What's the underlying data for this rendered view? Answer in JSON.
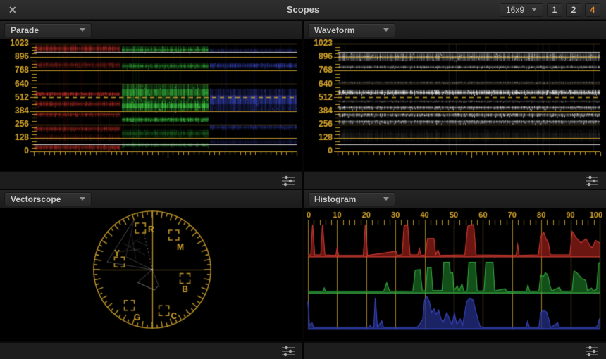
{
  "titlebar": {
    "close_glyph": "✕",
    "title": "Scopes",
    "aspect_value": "16x9",
    "layout_options": [
      "1",
      "2",
      "4"
    ],
    "active_layout": "4",
    "accent_color": "#e8872b"
  },
  "panels": {
    "parade": {
      "label": "Parade"
    },
    "waveform": {
      "label": "Waveform"
    },
    "vectorscope": {
      "label": "Vectorscope"
    },
    "histogram": {
      "label": "Histogram"
    }
  },
  "scale": {
    "labels": [
      "1023",
      "896",
      "768",
      "640",
      "512",
      "384",
      "256",
      "128",
      "0"
    ],
    "max": 1023,
    "dashed_value": 512,
    "white_lines": [
      940,
      64
    ],
    "grid_color": "#c49a2a",
    "label_color": "#d9a92c",
    "white_line_color": "#e6e6e6"
  },
  "chart_data": {
    "parade": {
      "type": "waveform-parade",
      "seed": 7,
      "channels": [
        {
          "name": "red",
          "color": "#e83a2e",
          "bands": [
            [
              975,
              35,
              0.5
            ],
            [
              820,
              30,
              0.3
            ],
            [
              545,
              20,
              0.65
            ],
            [
              450,
              25,
              0.4
            ],
            [
              350,
              20,
              0.45
            ],
            [
              215,
              25,
              0.4
            ],
            [
              130,
              30,
              0.18
            ],
            [
              40,
              28,
              0.45
            ]
          ]
        },
        {
          "name": "green",
          "color": "#44e04a",
          "bands": [
            [
              965,
              30,
              0.45
            ],
            [
              810,
              25,
              0.4
            ],
            [
              560,
              75,
              0.55
            ],
            [
              430,
              55,
              0.75
            ],
            [
              300,
              25,
              0.6
            ],
            [
              170,
              40,
              0.25
            ],
            [
              60,
              20,
              0.3
            ]
          ]
        },
        {
          "name": "blue",
          "color": "#4656e8",
          "bands": [
            [
              955,
              25,
              0.22
            ],
            [
              815,
              28,
              0.45
            ],
            [
              490,
              105,
              0.5
            ],
            [
              230,
              20,
              0.35
            ],
            [
              90,
              30,
              0.15
            ]
          ]
        }
      ]
    },
    "waveform": {
      "type": "waveform-luma",
      "seed": 13,
      "channels": [
        {
          "name": "luma",
          "color": "#e8e8e8",
          "bands": [
            [
              895,
              35,
              0.55
            ],
            [
              800,
              12,
              0.4
            ],
            [
              655,
              10,
              0.25
            ],
            [
              560,
              22,
              0.85
            ],
            [
              475,
              10,
              0.25
            ],
            [
              415,
              18,
              0.55
            ],
            [
              345,
              15,
              0.65
            ],
            [
              280,
              18,
              0.5
            ],
            [
              150,
              60,
              0.08
            ]
          ]
        }
      ]
    },
    "vectorscope": {
      "type": "vectorscope",
      "targets": [
        {
          "name": "R",
          "x": -0.2,
          "y": -0.71,
          "lx": -0.02,
          "ly": -0.68
        },
        {
          "name": "M",
          "x": 0.37,
          "y": -0.59,
          "lx": 0.48,
          "ly": -0.38
        },
        {
          "name": "Y",
          "x": -0.56,
          "y": -0.13,
          "lx": -0.6,
          "ly": -0.27
        },
        {
          "name": "B",
          "x": 0.56,
          "y": 0.15,
          "lx": 0.56,
          "ly": 0.34
        },
        {
          "name": "G",
          "x": -0.39,
          "y": 0.61,
          "lx": -0.26,
          "ly": 0.82
        },
        {
          "name": "C",
          "x": 0.2,
          "y": 0.7,
          "lx": 0.37,
          "ly": 0.8
        }
      ],
      "trace": [
        [
          -0.31,
          -0.85,
          -0.77,
          -0.13,
          0.35,
          0
        ],
        [
          0,
          0,
          -0.77,
          -0.13,
          0.3,
          0
        ],
        [
          0,
          0,
          -0.45,
          -0.22,
          0.3,
          0
        ],
        [
          -0.45,
          -0.22,
          -0.31,
          -0.85,
          0.2,
          0
        ],
        [
          -0.6,
          -0.3,
          -0.2,
          -0.35,
          0.2,
          0
        ],
        [
          -0.5,
          -0.45,
          -0.12,
          -0.25,
          0.2,
          0
        ],
        [
          -0.35,
          -0.6,
          -0.28,
          -0.18,
          0.18,
          0
        ],
        [
          -0.06,
          -0.4,
          -0.3,
          -0.5,
          0.18,
          0
        ],
        [
          -0.2,
          -0.55,
          -0.5,
          -0.3,
          0.15,
          0
        ],
        [
          -0.15,
          -0.66,
          0,
          -0.02,
          0.45,
          1
        ],
        [
          0,
          0,
          -0.25,
          0.22,
          0.35,
          0
        ],
        [
          -0.25,
          0.22,
          0.04,
          0.35,
          0.55,
          0
        ],
        [
          0.04,
          0.35,
          0.1,
          0.28,
          0.55,
          0
        ],
        [
          0,
          0,
          0.12,
          0.3,
          0.3,
          0
        ]
      ]
    },
    "histogram": {
      "type": "area",
      "axis_ticks": [
        0,
        10,
        20,
        30,
        40,
        50,
        60,
        70,
        80,
        90,
        100
      ],
      "series": [
        {
          "name": "red",
          "line": "#e04438",
          "fill": "rgba(150,30,25,0.72)",
          "points": [
            [
              0,
              0.05
            ],
            [
              1,
              0.05
            ],
            [
              1.6,
              1
            ],
            [
              2.3,
              0.05
            ],
            [
              4.4,
              0.05
            ],
            [
              5,
              1
            ],
            [
              5.8,
              0.05
            ],
            [
              9.6,
              0.03
            ],
            [
              10,
              0.26
            ],
            [
              10.5,
              0.03
            ],
            [
              19,
              0.03
            ],
            [
              19.7,
              1
            ],
            [
              20.4,
              0.03
            ],
            [
              30.2,
              0.16
            ],
            [
              30.7,
              0.03
            ],
            [
              32.3,
              0.06
            ],
            [
              33,
              0.97
            ],
            [
              34.2,
              0.97
            ],
            [
              35,
              0.05
            ],
            [
              37.7,
              0.05
            ],
            [
              38.2,
              0.24
            ],
            [
              38.8,
              0.03
            ],
            [
              40.3,
              0.05
            ],
            [
              41,
              0.56
            ],
            [
              43.2,
              0.56
            ],
            [
              43.8,
              0.05
            ],
            [
              44.6,
              0.2
            ],
            [
              45.2,
              0.03
            ],
            [
              53.8,
              0.05
            ],
            [
              54.8,
              0.95
            ],
            [
              56.8,
              1
            ],
            [
              57.6,
              0.05
            ],
            [
              71.4,
              0.03
            ],
            [
              71.9,
              0.36
            ],
            [
              72.4,
              0.03
            ],
            [
              79,
              0.05
            ],
            [
              79.8,
              0.62
            ],
            [
              80.8,
              0.76
            ],
            [
              81.6,
              0.56
            ],
            [
              82.4,
              0.42
            ],
            [
              83.1,
              0.05
            ],
            [
              89.8,
              0.05
            ],
            [
              90.6,
              0.78
            ],
            [
              91.8,
              0.6
            ],
            [
              93.6,
              0.42
            ],
            [
              95.3,
              0.56
            ],
            [
              96.3,
              0.4
            ],
            [
              97.4,
              0.26
            ],
            [
              98.6,
              0.5
            ],
            [
              100,
              0.42
            ]
          ]
        },
        {
          "name": "green",
          "line": "#3fbf4a",
          "fill": "rgba(25,110,35,0.72)",
          "points": [
            [
              0,
              0.04
            ],
            [
              5.2,
              0.04
            ],
            [
              5.6,
              0.14
            ],
            [
              6,
              0.04
            ],
            [
              26,
              0.04
            ],
            [
              27,
              0.3
            ],
            [
              28,
              0.04
            ],
            [
              36,
              0.05
            ],
            [
              36.8,
              0.7
            ],
            [
              38.4,
              0.72
            ],
            [
              39.2,
              0.05
            ],
            [
              40.4,
              0.06
            ],
            [
              41,
              0.78
            ],
            [
              42.2,
              0.78
            ],
            [
              42.8,
              0.06
            ],
            [
              46,
              0.06
            ],
            [
              46.6,
              0.95
            ],
            [
              48.4,
              0.95
            ],
            [
              48.8,
              0.62
            ],
            [
              49.6,
              0.62
            ],
            [
              50,
              0.06
            ],
            [
              51.2,
              0.2
            ],
            [
              51.8,
              0.04
            ],
            [
              52.8,
              0.26
            ],
            [
              53.4,
              0.04
            ],
            [
              54.6,
              0.05
            ],
            [
              55.2,
              0.95
            ],
            [
              57.4,
              0.95
            ],
            [
              58,
              0.05
            ],
            [
              60.4,
              0.05
            ],
            [
              61,
              0.95
            ],
            [
              63.4,
              0.95
            ],
            [
              64,
              0.05
            ],
            [
              67.6,
              0.12
            ],
            [
              68.2,
              0.03
            ],
            [
              74.9,
              0.04
            ],
            [
              75.4,
              0.22
            ],
            [
              76,
              0.04
            ],
            [
              79.2,
              0.05
            ],
            [
              79.8,
              0.55
            ],
            [
              80.6,
              0.48
            ],
            [
              81.4,
              0.62
            ],
            [
              82.2,
              0.55
            ],
            [
              83,
              0.2
            ],
            [
              83.6,
              0.05
            ],
            [
              86.2,
              0.16
            ],
            [
              86.8,
              0.04
            ],
            [
              90.6,
              0.05
            ],
            [
              91.2,
              0.68
            ],
            [
              92.4,
              0.6
            ],
            [
              93.8,
              0.44
            ],
            [
              95.2,
              0.38
            ],
            [
              95.8,
              0.06
            ],
            [
              97.2,
              0.14
            ],
            [
              97.8,
              0.05
            ],
            [
              99,
              0.1
            ],
            [
              99.6,
              0.9
            ],
            [
              100,
              0.95
            ]
          ]
        },
        {
          "name": "blue",
          "line": "#4353e0",
          "fill": "rgba(35,45,130,0.78)",
          "points": [
            [
              0,
              0.85
            ],
            [
              0.5,
              0.1
            ],
            [
              1.4,
              0.18
            ],
            [
              2,
              0.04
            ],
            [
              20.8,
              0.04
            ],
            [
              21.3,
              0.1
            ],
            [
              21.8,
              0.04
            ],
            [
              22.6,
              0.04
            ],
            [
              23.1,
              0.95
            ],
            [
              23.8,
              0.04
            ],
            [
              25.3,
              0.24
            ],
            [
              25.9,
              0.04
            ],
            [
              37.4,
              0.04
            ],
            [
              38.2,
              0.12
            ],
            [
              39.4,
              0.3
            ],
            [
              40,
              0.9
            ],
            [
              40.8,
              1
            ],
            [
              41.6,
              0.85
            ],
            [
              42.4,
              0.5
            ],
            [
              43.2,
              0.62
            ],
            [
              44,
              0.45
            ],
            [
              44.8,
              0.58
            ],
            [
              45.6,
              0.3
            ],
            [
              46.4,
              0.2
            ],
            [
              47.6,
              0.5
            ],
            [
              48.6,
              0.28
            ],
            [
              49.4,
              0.12
            ],
            [
              50.2,
              0.48
            ],
            [
              51,
              0.14
            ],
            [
              52.2,
              0.3
            ],
            [
              53,
              0.1
            ],
            [
              53.8,
              0.5
            ],
            [
              54.4,
              0.85
            ],
            [
              55.4,
              0.95
            ],
            [
              56.6,
              0.9
            ],
            [
              57.4,
              0.6
            ],
            [
              58.2,
              0.3
            ],
            [
              59,
              0.08
            ],
            [
              60,
              0.04
            ],
            [
              74.8,
              0.04
            ],
            [
              75.3,
              0.22
            ],
            [
              75.9,
              0.04
            ],
            [
              79.2,
              0.04
            ],
            [
              79.8,
              0.5
            ],
            [
              80.8,
              0.58
            ],
            [
              81.8,
              0.52
            ],
            [
              82.6,
              0.28
            ],
            [
              83.2,
              0.04
            ],
            [
              85.6,
              0.18
            ],
            [
              86.2,
              0.04
            ],
            [
              98.8,
              0.04
            ],
            [
              99.4,
              0.12
            ],
            [
              100,
              0.32
            ]
          ]
        }
      ]
    }
  }
}
